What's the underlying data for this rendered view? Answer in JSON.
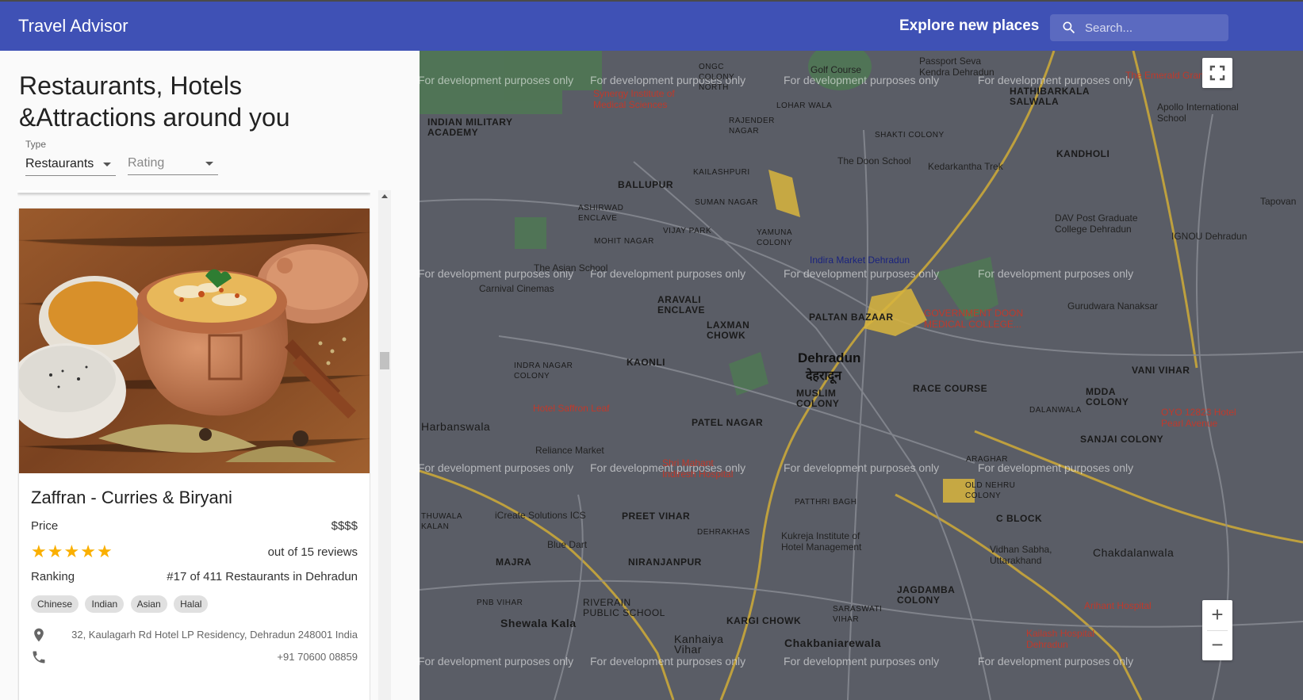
{
  "header": {
    "title": "Travel Advisor",
    "explore": "Explore new places",
    "search_placeholder": "Search..."
  },
  "sidebar": {
    "heading": "Restaurants, Hotels &Attractions around you",
    "type_label": "Type",
    "type_value": "Restaurants",
    "rating_placeholder": "Rating"
  },
  "place": {
    "name": "Zaffran - Curries & Biryani",
    "price_label": "Price",
    "price_value": "$$$$",
    "rating": 5,
    "reviews": "out of 15 reviews",
    "ranking_label": "Ranking",
    "ranking_value": "#17 of 411 Restaurants in Dehradun",
    "cuisines": [
      "Chinese",
      "Indian",
      "Asian",
      "Halal"
    ],
    "address": "32, Kaulagarh Rd Hotel LP Residency, Dehradun 248001 India",
    "phone": "+91 70600 08859",
    "icons": {
      "address": "location-pin-icon",
      "phone": "phone-icon"
    }
  },
  "map": {
    "watermark": "For development purposes only",
    "city": "Dehradun",
    "city_hi": "देहरादून",
    "labels": [
      "INDIAN MILITARY ACADEMY",
      "BALLUPUR",
      "KAILASHPURI",
      "ASHIRWAD ENCLAVE",
      "MOHIT NAGAR",
      "VIJAY PARK",
      "SUMAN NAGAR",
      "YAMUNA COLONY",
      "SHAKTI COLONY",
      "HATHIBARKALA SALWALA",
      "KANDHOLI",
      "ARAVALI ENCLAVE",
      "LAXMAN CHOWK",
      "KAONLI",
      "PALTAN BAZAAR",
      "INDRA NAGAR COLONY",
      "MUSLIM COLONY",
      "RACE COURSE",
      "PATEL NAGAR",
      "VANI VIHAR",
      "SANJAI COLONY",
      "MDDA COLONY",
      "PREET VIHAR",
      "DEHRAKHAS",
      "NIRANJANPUR",
      "MAJRA",
      "JAGDAMBA COLONY",
      "KARGI CHOWK",
      "Chakbaniarewala",
      "Shewala Kala",
      "Kanhaiya Vihar",
      "Harbanswala",
      "Chakdalanwala",
      "LOHAR WALA",
      "RAJENDER NAGAR",
      "ONGC COLONY NORTH",
      "PATTHRI BAGH",
      "OLD NEHRU COLONY",
      "C BLOCK",
      "SARASWATI VIHAR",
      "RIVERAIN PUBLIC SCHOOL",
      "PNB VIHAR",
      "THUWALA KALAN",
      "DALANWALA",
      "ARAGHAR"
    ],
    "pois": [
      "Synergy Institute of Medical Sciences",
      "Golf Course",
      "Passport Seva Kendra Dehradun",
      "The Doon School",
      "Kedarkantha Trek",
      "DAV Post Graduate College Dehradun",
      "Indira Market Dehradun",
      "GOVERNMENT DOON MEDICAL COLLEGE...",
      "Gurudwara Nanaksar",
      "Carnival Cinemas",
      "The Asian School",
      "Hotel Saffron Leaf",
      "Reliance Market",
      "Shri Mahant Indiresh Hospital",
      "iCreate Solutions ICS",
      "Blue Dart",
      "Kukreja Institute of Hotel Management",
      "Vidhan Sabha, Uttarakhand",
      "Arihant Hospital",
      "Kailash Hospital Dehradun",
      "OYO 12823 Hotel Pearl Avenue",
      "IGNOU Dehradun",
      "Apollo International School",
      "Tapovan",
      "The Emerald Grand"
    ]
  },
  "map_controls": {
    "zoom_in": "+",
    "zoom_out": "−"
  }
}
